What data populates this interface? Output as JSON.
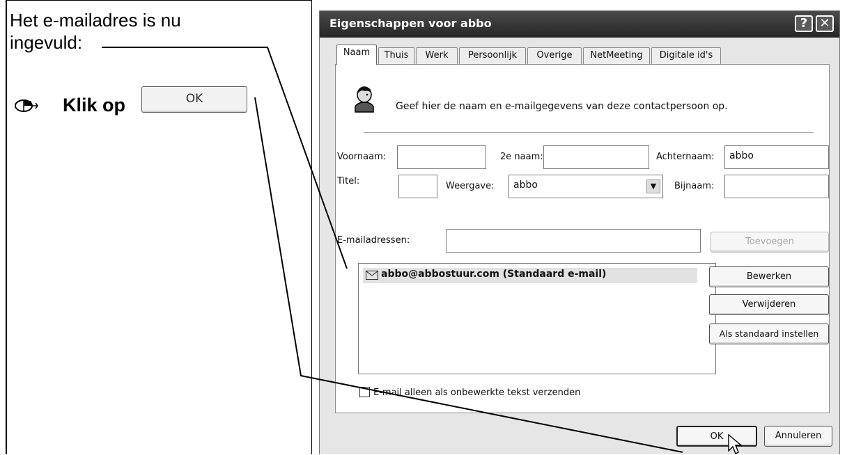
{
  "instruction": {
    "line1": "Het e-mailadres is nu",
    "line2": "ingevuld:",
    "klik_label": "Klik op",
    "button_image_label": "OK",
    "mouse_icon": "mouse-icon"
  },
  "dialog": {
    "title": "Eigenschappen voor abbo",
    "help_btn": "?",
    "close_btn": "✕",
    "tabs": [
      "Naam",
      "Thuis",
      "Werk",
      "Persoonlijk",
      "Overige",
      "NetMeeting",
      "Digitale id's"
    ],
    "header_text": "Geef hier de naam en e-mailgegevens van deze contactpersoon op.",
    "header_icon": "contact-person-icon",
    "fields": {
      "voornaam_label": "Voornaam:",
      "voornaam_value": "",
      "tweede_naam_label": "2e naam:",
      "tweede_naam_value": "",
      "achternaam_label": "Achternaam:",
      "achternaam_value": "abbo",
      "titel_label": "Titel:",
      "titel_value": "",
      "weergave_label": "Weergave:",
      "weergave_value": "abbo",
      "bijnaam_label": "Bijnaam:",
      "bijnaam_value": "",
      "email_label": "E-mailadressen:",
      "email_value": ""
    },
    "buttons": {
      "toevoegen": "Toevoegen",
      "bewerken": "Bewerken",
      "verwijderen": "Verwijderen",
      "standaard": "Als standaard instellen",
      "ok": "OK",
      "annuleren": "Annuleren"
    },
    "email_list": [
      "abbo@abbostuur.com  (Standaard e-mail)"
    ],
    "checkbox_label": "E-mail alleen als onbewerkte tekst verzenden",
    "checkbox_checked": false
  }
}
